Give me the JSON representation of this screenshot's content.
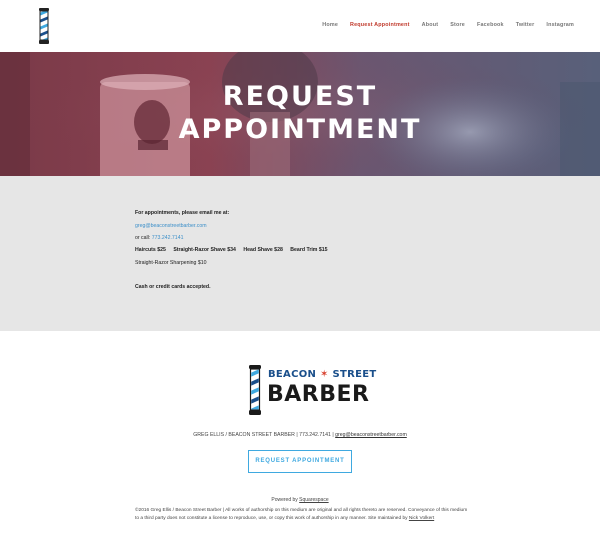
{
  "nav": {
    "items": [
      {
        "label": "Home"
      },
      {
        "label": "Request Appointment"
      },
      {
        "label": "About"
      },
      {
        "label": "Store"
      },
      {
        "label": "Facebook"
      },
      {
        "label": "Twitter"
      },
      {
        "label": "Instagram"
      }
    ],
    "active_color": "#c0392b"
  },
  "hero": {
    "title_line1": "REQUEST",
    "title_line2": "APPOINTMENT"
  },
  "content": {
    "intro": "For appointments, please email me at:",
    "email": "greg@beaconstreetbarber.com",
    "call_prefix": "or call:",
    "phone": "773.242.7141",
    "haircuts": "Haircuts $25",
    "shave": "Straight-Razor Shave $34",
    "head_shave": "Head Shave $28",
    "beard_trim": "Beard Trim $15",
    "sharpening": "Straight-Razor Sharpening $10",
    "payment": "Cash or credit cards accepted."
  },
  "footer": {
    "brand_top_left": "BEACON",
    "brand_star": "✶",
    "brand_top_right": "STREET",
    "brand_bottom": "BARBER",
    "contact_prefix": "GREG ELLIS / BEACON STREET BARBER",
    "contact_sep": "|",
    "contact_phone": "773.242.7141",
    "contact_email": "greg@beaconstreetbarber.com",
    "button_label": "REQUEST APPOINTMENT",
    "powered_prefix": "Powered by",
    "powered_link": "Squarespace",
    "legal_text": "©2016 Greg Ellis / Beacon Street Barber | All works of authorship on this medium are original and all rights thereto are reserved. Conveyance of this medium to a third party does not constitute a license to reproduce, use, or copy this work of authorship in any manner. Site maintained by",
    "legal_link": "Nick Volkert"
  },
  "colors": {
    "accent_blue": "#3fa9e0",
    "brand_blue": "#1a4f8b",
    "brand_red": "#d8412f",
    "content_bg": "#e6e6e6"
  }
}
